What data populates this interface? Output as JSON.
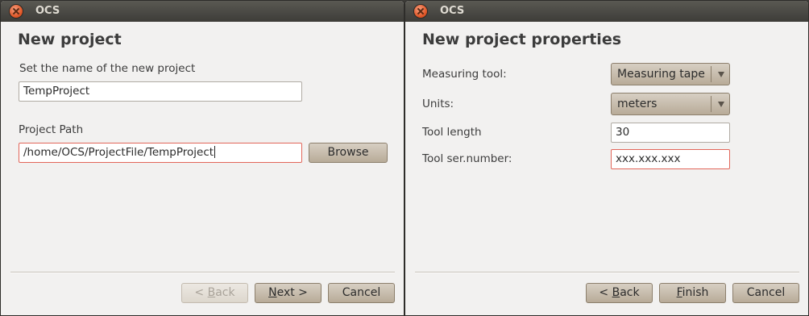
{
  "window1": {
    "title": "OCS",
    "heading": "New project",
    "name_label": "Set the name of the new project",
    "name_value": "TempProject",
    "path_label": "Project Path",
    "path_value": "/home/OCS/ProjectFile/TempProject",
    "browse_label": "Browse",
    "back_prefix": "< ",
    "back_mnemonic": "B",
    "back_rest": "ack",
    "next_mnemonic": "N",
    "next_rest": "ext >",
    "cancel_label": "Cancel"
  },
  "window2": {
    "title": "OCS",
    "heading": "New project properties",
    "measuring_tool_label": "Measuring tool:",
    "measuring_tool_value": "Measuring tape",
    "units_label": "Units:",
    "units_value": "meters",
    "tool_length_label": "Tool length",
    "tool_length_value": "30",
    "serial_label": "Tool ser.number:",
    "serial_value": "xxx.xxx.xxx",
    "back_prefix": "< ",
    "back_mnemonic": "B",
    "back_rest": "ack",
    "finish_mnemonic": "F",
    "finish_rest": "inish",
    "cancel_label": "Cancel"
  },
  "icons": {
    "close": "close-icon",
    "dropdown": "chevron-down-icon"
  },
  "colors": {
    "titlebar": "#3d3c38",
    "close_button": "#e25a2b",
    "button": "#c7bcad",
    "error_border": "#e2665a"
  }
}
